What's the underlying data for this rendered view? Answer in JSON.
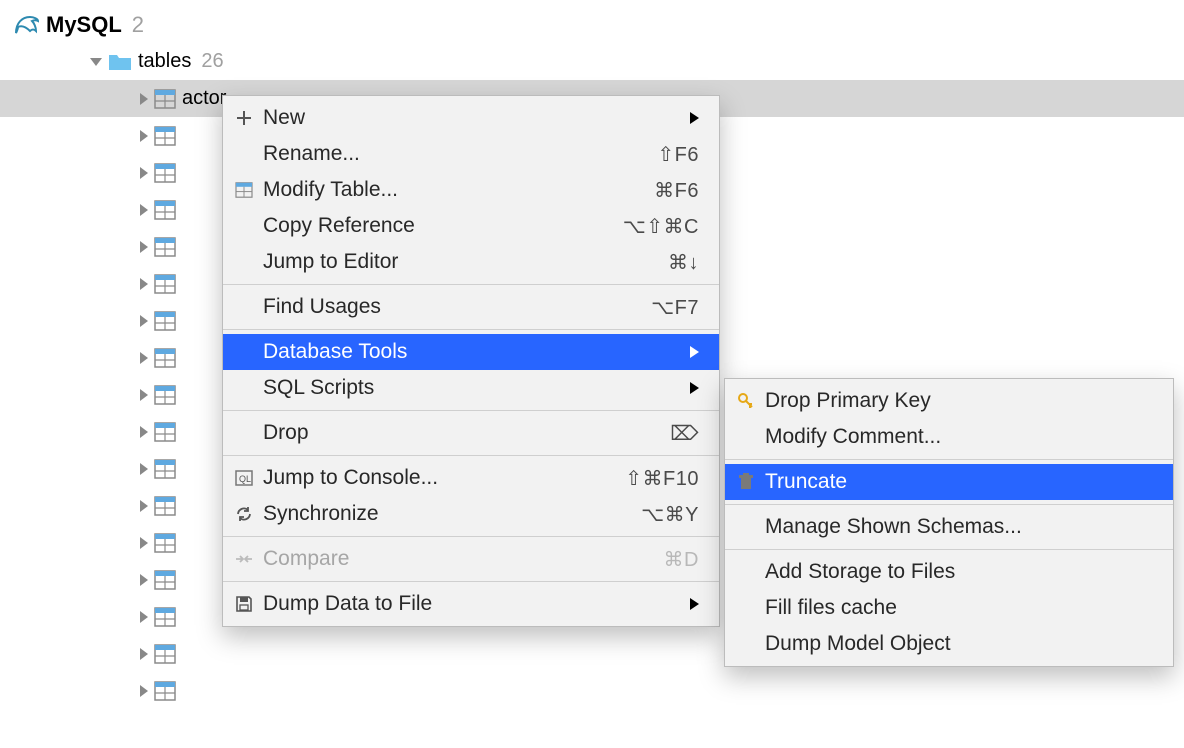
{
  "tree": {
    "db": {
      "name": "MySQL",
      "count": "2"
    },
    "folder": {
      "name": "tables",
      "count": "26"
    },
    "selected_table": "actor",
    "blank_rows": 16
  },
  "menu1": {
    "new": "New",
    "rename": "Rename...",
    "rename_sc": "⇧F6",
    "modify_table": "Modify Table...",
    "modify_table_sc": "⌘F6",
    "copy_ref": "Copy Reference",
    "copy_ref_sc": "⌥⇧⌘C",
    "jump_editor": "Jump to Editor",
    "jump_editor_sc": "⌘↓",
    "find_usages": "Find Usages",
    "find_usages_sc": "⌥F7",
    "db_tools": "Database Tools",
    "sql_scripts": "SQL Scripts",
    "drop": "Drop",
    "drop_sc": "⌦",
    "jump_console": "Jump to Console...",
    "jump_console_sc": "⇧⌘F10",
    "sync": "Synchronize",
    "sync_sc": "⌥⌘Y",
    "compare": "Compare",
    "compare_sc": "⌘D",
    "dump": "Dump Data to File"
  },
  "menu2": {
    "drop_pk": "Drop Primary Key",
    "modify_comment": "Modify Comment...",
    "truncate": "Truncate",
    "manage_schemas": "Manage Shown Schemas...",
    "add_storage": "Add Storage to Files",
    "fill_cache": "Fill files cache",
    "dump_model": "Dump Model Object"
  }
}
